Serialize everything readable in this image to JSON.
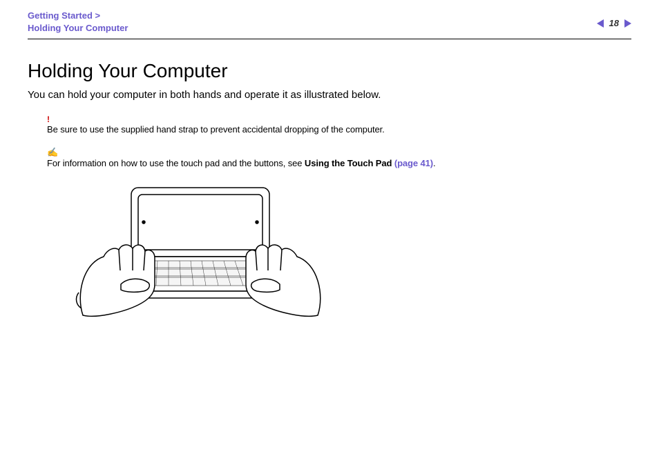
{
  "header": {
    "breadcrumb_line1": "Getting Started >",
    "breadcrumb_line2": "Holding Your Computer",
    "page_number": "18"
  },
  "title": "Holding Your Computer",
  "intro": "You can hold your computer in both hands and operate it as illustrated below.",
  "warning": {
    "mark": "!",
    "text": "Be sure to use the supplied hand strap to prevent accidental dropping of the computer."
  },
  "tip": {
    "mark": "✍",
    "text_before": "For information on how to use the touch pad and the buttons, see ",
    "bold_text": "Using the Touch Pad ",
    "link_text": "(page 41)",
    "text_after": "."
  }
}
